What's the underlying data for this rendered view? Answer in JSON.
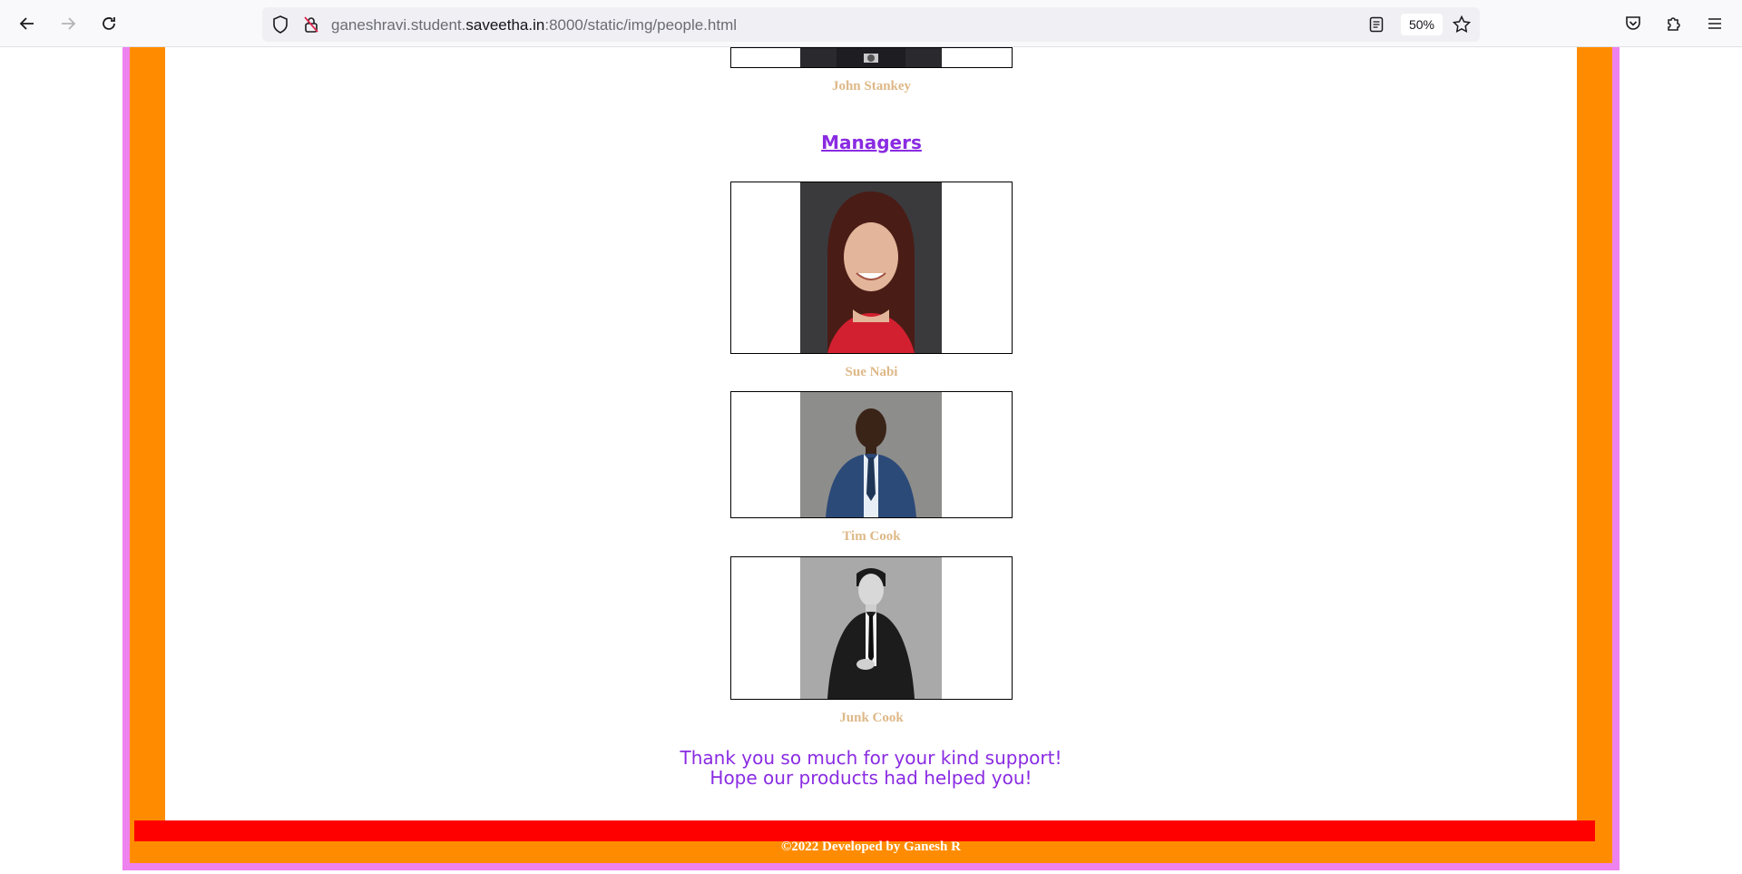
{
  "browser": {
    "url_prefix": "ganeshravi.student.",
    "url_host": "saveetha.in",
    "url_suffix": ":8000/static/img/people.html",
    "zoom": "50%"
  },
  "people_top": [
    {
      "name": "John Stankey"
    }
  ],
  "managers": {
    "heading": "Managers",
    "people": [
      {
        "name": "Sue Nabi"
      },
      {
        "name": "Tim Cook"
      },
      {
        "name": "Junk Cook"
      }
    ]
  },
  "thanks": {
    "line1": "Thank you so much for your kind support!",
    "line2": "Hope our products had helped you!"
  },
  "footer": {
    "text": "©2022 Developed by Ganesh R"
  },
  "colors": {
    "outer_border": "#ee82ee",
    "frame": "#ff8c00",
    "footer_bar": "#ff0000",
    "name_color": "#deb887",
    "heading_color": "#8a2be2"
  }
}
